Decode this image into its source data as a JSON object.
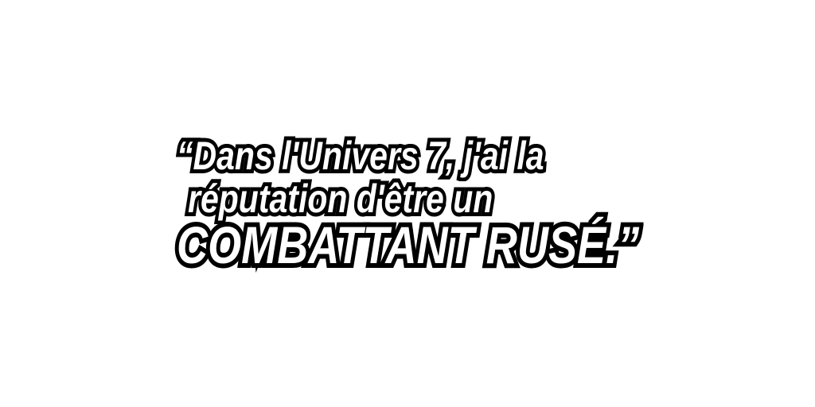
{
  "quote": {
    "line1": "“Dans l'Univers 7, j'ai la",
    "line2": "réputation d'être un",
    "line3": "COMBATTANT RUSÉ.”"
  }
}
